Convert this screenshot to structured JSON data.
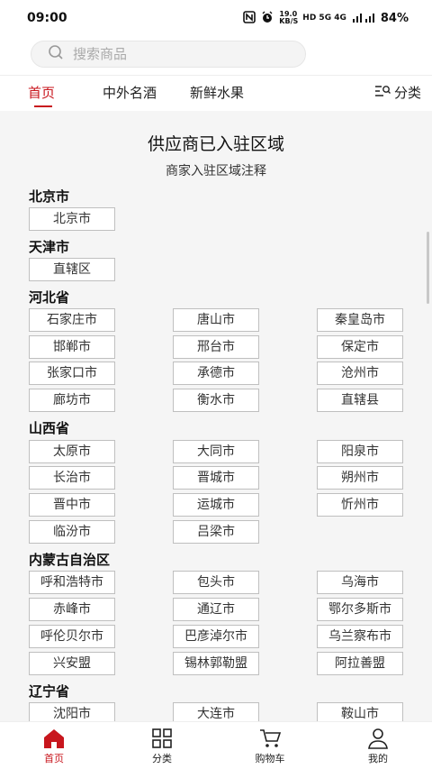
{
  "status_bar": {
    "time": "09:00",
    "net_speed": "19.0 KB/S",
    "network": "HD 5G 4G",
    "battery": "84%"
  },
  "search": {
    "placeholder": "搜索商品"
  },
  "tabs": [
    {
      "label": "首页",
      "active": true
    },
    {
      "label": "中外名酒",
      "active": false
    },
    {
      "label": "新鲜水果",
      "active": false
    }
  ],
  "category_tab": {
    "label": "分类"
  },
  "page": {
    "title": "供应商已入驻区域",
    "subtitle": "商家入驻区域注释"
  },
  "provinces": [
    {
      "name": "北京市",
      "cities": [
        "北京市"
      ]
    },
    {
      "name": "天津市",
      "cities": [
        "直辖区"
      ]
    },
    {
      "name": "河北省",
      "cities": [
        "石家庄市",
        "唐山市",
        "秦皇岛市",
        "邯郸市",
        "邢台市",
        "保定市",
        "张家口市",
        "承德市",
        "沧州市",
        "廊坊市",
        "衡水市",
        "直辖县"
      ]
    },
    {
      "name": "山西省",
      "cities": [
        "太原市",
        "大同市",
        "阳泉市",
        "长治市",
        "晋城市",
        "朔州市",
        "晋中市",
        "运城市",
        "忻州市",
        "临汾市",
        "吕梁市"
      ]
    },
    {
      "name": "内蒙古自治区",
      "cities": [
        "呼和浩特市",
        "包头市",
        "乌海市",
        "赤峰市",
        "通辽市",
        "鄂尔多斯市",
        "呼伦贝尔市",
        "巴彦淖尔市",
        "乌兰察布市",
        "兴安盟",
        "锡林郭勒盟",
        "阿拉善盟"
      ]
    },
    {
      "name": "辽宁省",
      "cities": [
        "沈阳市",
        "大连市",
        "鞍山市"
      ]
    }
  ],
  "bottom_nav": [
    {
      "label": "首页",
      "icon": "home-icon",
      "active": true
    },
    {
      "label": "分类",
      "icon": "grid-icon",
      "active": false
    },
    {
      "label": "购物车",
      "icon": "cart-icon",
      "active": false
    },
    {
      "label": "我的",
      "icon": "user-icon",
      "active": false
    }
  ],
  "colors": {
    "accent": "#c8161d",
    "background": "#f5f5f5",
    "button_border": "#bfbfbf"
  }
}
